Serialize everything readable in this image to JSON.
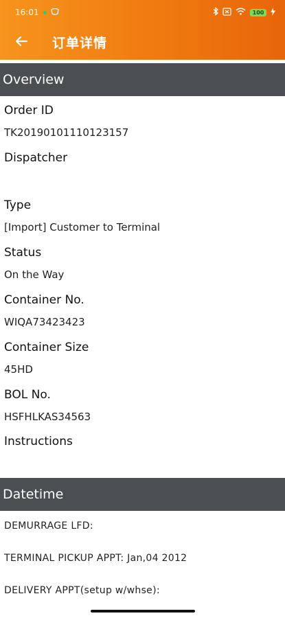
{
  "status_bar": {
    "time": "16:01",
    "battery": "100"
  },
  "header": {
    "title": "订单详情",
    "back_icon": "arrow-left-icon",
    "colors": {
      "start": "#f7941d",
      "end": "#e8650a"
    }
  },
  "overview": {
    "section_title": "Overview",
    "fields": [
      {
        "label": "Order ID",
        "value": "TK20190101110123157"
      },
      {
        "label": "Dispatcher",
        "value": ""
      },
      {
        "label": "Type",
        "value": "[Import] Customer to Terminal"
      },
      {
        "label": "Status",
        "value": "On the Way"
      },
      {
        "label": "Container No.",
        "value": "WIQA73423423"
      },
      {
        "label": "Container Size",
        "value": "45HD"
      },
      {
        "label": "BOL No.",
        "value": "HSFHLKAS34563"
      },
      {
        "label": "Instructions",
        "value": ""
      }
    ]
  },
  "datetime": {
    "section_title": "Datetime",
    "lines": [
      "DEMURRAGE LFD:",
      "TERMINAL PICKUP APPT: Jan,04 2012",
      "DELIVERY APPT(setup w/whse):"
    ]
  },
  "colors": {
    "section_header_bg": "#4b4f53"
  }
}
